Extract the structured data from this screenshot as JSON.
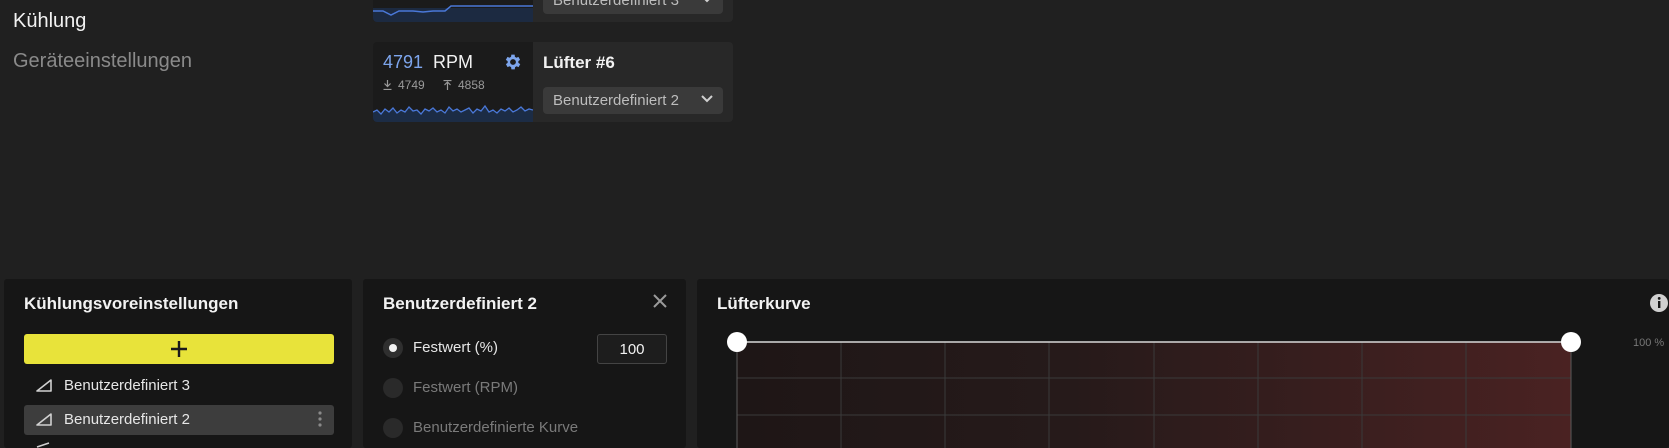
{
  "nav": {
    "active": "Kühlung",
    "inactive": "Geräteeinstellungen"
  },
  "top_card": {
    "select_value": "Benutzerdefiniert 3"
  },
  "fan6": {
    "rpm_value": "4791",
    "rpm_unit": "RPM",
    "min": "4749",
    "max": "4858",
    "name": "Lüfter #6",
    "select_value": "Benutzerdefiniert 2"
  },
  "presets_panel": {
    "title": "Kühlungsvoreinstellungen",
    "items": [
      {
        "label": "Benutzerdefiniert 3"
      },
      {
        "label": "Benutzerdefiniert 2"
      }
    ]
  },
  "preset_detail": {
    "title": "Benutzerdefiniert 2",
    "options": [
      {
        "label": "Festwert (%)"
      },
      {
        "label": "Festwert (RPM)"
      },
      {
        "label": "Benutzerdefinierte Kurve"
      }
    ],
    "fixed_value": "100"
  },
  "curve_panel": {
    "title": "Lüfterkurve",
    "y_label": "100 %"
  },
  "colors": {
    "accent_yellow": "#e8e33a",
    "rpm_blue": "#7da5ec",
    "sparkline": "#4a78d8"
  },
  "icons": [
    "gear-icon",
    "download-icon",
    "upload-icon",
    "chevron-down-icon",
    "plus-icon",
    "curve-icon",
    "kebab-icon",
    "close-icon",
    "info-icon"
  ]
}
